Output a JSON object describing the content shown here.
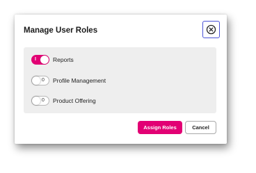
{
  "dialog": {
    "title": "Manage User Roles",
    "close_icon": "close-circle-icon"
  },
  "roles": [
    {
      "label": "Reports",
      "enabled": true,
      "state_mark": "I"
    },
    {
      "label": "Profile Management",
      "enabled": false,
      "state_mark": "0"
    },
    {
      "label": "Product Offering",
      "enabled": false,
      "state_mark": "0"
    }
  ],
  "actions": {
    "assign_label": "Assign Roles",
    "cancel_label": "Cancel"
  },
  "colors": {
    "accent": "#e20074",
    "focus_ring": "#4a52d6",
    "panel_bg": "#eeeeee"
  }
}
